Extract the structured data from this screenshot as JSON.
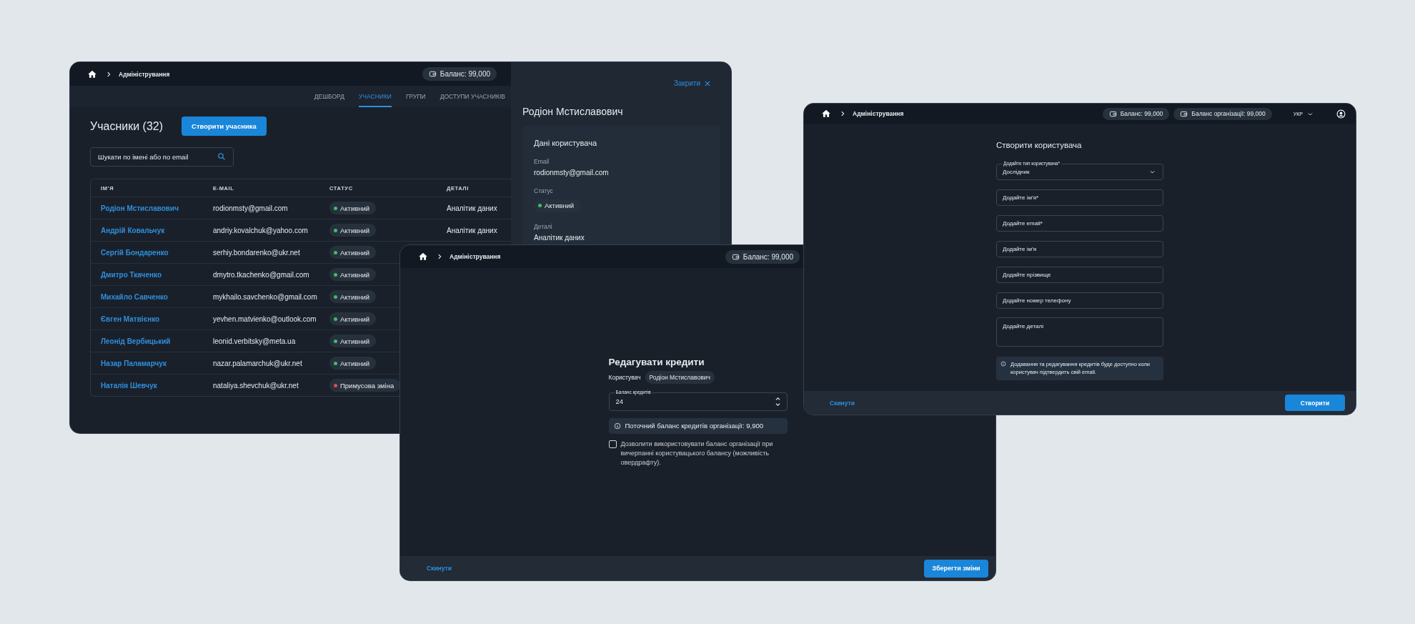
{
  "members_window": {
    "breadcrumb": "Адміністрування",
    "balance": "Баланс: 99,000",
    "tabs": [
      {
        "label": "ДЕШБОРД",
        "selected": false
      },
      {
        "label": "УЧАСНИКИ",
        "selected": true
      },
      {
        "label": "ГРУПИ",
        "selected": false
      },
      {
        "label": "ДОСТУПИ УЧАСНИКІВ",
        "selected": false
      }
    ],
    "title": "Учасники (32)",
    "create_button": "Створити учасника",
    "search": {
      "placeholder": "Шукати по імені або по email"
    },
    "table": {
      "columns": [
        "ІМ’Я",
        "E-MAIL",
        "СТАТУС",
        "ДЕТАЛІ"
      ],
      "rows": [
        {
          "name": "Родіон Мстиславович",
          "email": "rodionmsty@gmail.com",
          "status": {
            "label": "Активний",
            "color": "#3fbf5f"
          },
          "details": "Аналітик даних"
        },
        {
          "name": "Андрій Ковальчук",
          "email": "andriy.kovalchuk@yahoo.com",
          "status": {
            "label": "Активний",
            "color": "#3fbf5f"
          },
          "details": "Аналітик даних"
        },
        {
          "name": "Сергій Бондаренко",
          "email": "serhiy.bondarenko@ukr.net",
          "status": {
            "label": "Активний",
            "color": "#3fbf5f"
          }
        },
        {
          "name": "Дмитро Ткаченко",
          "email": "dmytro.tkachenko@gmail.com",
          "status": {
            "label": "Активний",
            "color": "#3fbf5f"
          }
        },
        {
          "name": "Михайло Савченко",
          "email": "mykhailo.savchenko@gmail.com",
          "status": {
            "label": "Активний",
            "color": "#3fbf5f"
          }
        },
        {
          "name": "Євген Матвієнко",
          "email": "yevhen.matvienko@outlook.com",
          "status": {
            "label": "Активний",
            "color": "#3fbf5f"
          }
        },
        {
          "name": "Леонід Вербицький",
          "email": "leonid.verbitsky@meta.ua",
          "status": {
            "label": "Активний",
            "color": "#3fbf5f"
          }
        },
        {
          "name": "Назар Паламарчук",
          "email": "nazar.palamarchuk@ukr.net",
          "status": {
            "label": "Активний",
            "color": "#3fbf5f"
          }
        },
        {
          "name": "Наталія Шевчук",
          "email": "nataliya.shevchuk@ukr.net",
          "status": {
            "label": "Примусова зміна",
            "color": "#e5484d"
          }
        }
      ]
    },
    "detail_panel": {
      "close_link": "Закрити",
      "title": "Родіон Мстиславович",
      "card": {
        "heading": "Дані користувача",
        "fields": [
          {
            "kind": "text",
            "label": "Email",
            "value": "rodionmsty@gmail.com"
          },
          {
            "kind": "status",
            "label": "Статус",
            "value": "Активний",
            "color": "#3fbf5f"
          },
          {
            "kind": "text",
            "label": "Деталі",
            "value": "Аналітик даних"
          }
        ]
      }
    }
  },
  "edit_credits_window": {
    "breadcrumb": "Адміністрування",
    "balance": "Баланс: 99,000",
    "title": "Редагувати кредити",
    "user_label": "Користувач",
    "user_name": "Родіон Мстиславович",
    "credit_field": {
      "label": "Баланс кредитів",
      "value": "24"
    },
    "info": "Поточний баланс кредитів організації: 9,900",
    "overdraft": {
      "label": "Дозволити використовувати баланс організації при вичерпанні користувацького балансу (можливість овердрафту).",
      "checked": false
    },
    "reset_link": "Скинути",
    "save_button": "Зберегти зміни"
  },
  "create_user_window": {
    "breadcrumb": "Адміністрування",
    "balance": "Баланс: 99,000",
    "org_balance": "Баланс організації: 99,000",
    "language": "УКР",
    "title": "Створити користувача",
    "user_type": {
      "label": "Додайте тип користувача*",
      "value": "Дослідник"
    },
    "fields": [
      {
        "kind": "input",
        "placeholder": "Додайте ім’я*"
      },
      {
        "kind": "input",
        "placeholder": "Додайте email*"
      },
      {
        "kind": "input",
        "placeholder": "Додайте ім’я"
      },
      {
        "kind": "input",
        "placeholder": "Додайте прізвище"
      },
      {
        "kind": "input",
        "placeholder": "Додайте номер телефону"
      },
      {
        "kind": "textarea",
        "placeholder": "Додайте деталі"
      }
    ],
    "info": "Додавання та редагування кредитів буде доступно коли користувач підтвердить свій email.",
    "reset_link": "Скинути",
    "create_button": "Створити"
  }
}
